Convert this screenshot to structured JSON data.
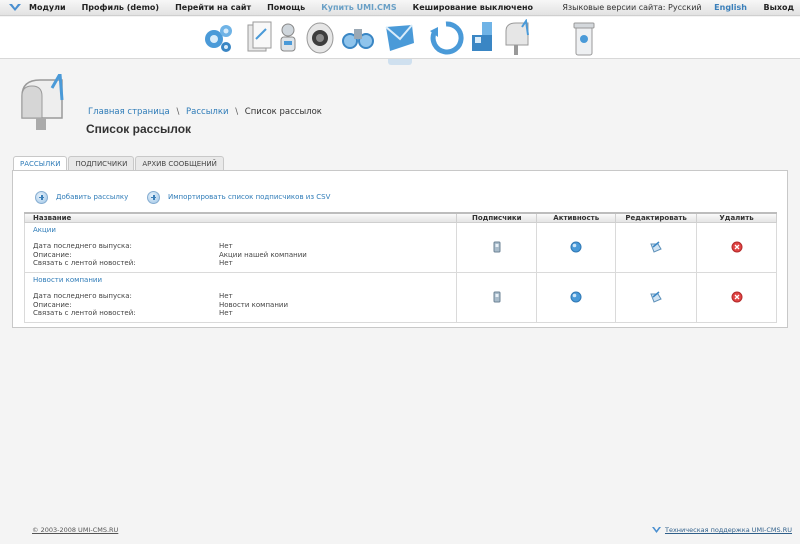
{
  "topbar": {
    "menu": [
      "Модули",
      "Профиль (demo)",
      "Перейти на сайт",
      "Помощь",
      "Купить UMI.CMS",
      "Кеширование выключено"
    ],
    "lang_label": "Языковые версии сайта: Русский",
    "lang_english": "English",
    "logout": "Выход"
  },
  "modules": [
    {
      "name": "settings-gears-icon"
    },
    {
      "name": "files-icon"
    },
    {
      "name": "users-icon"
    },
    {
      "name": "speaker-icon"
    },
    {
      "name": "binoculars-icon"
    },
    {
      "name": "dispatches-icon"
    },
    {
      "name": "sync-icon"
    },
    {
      "name": "data-blocks-icon"
    },
    {
      "name": "mailbox-icon"
    },
    {
      "name": "trash-icon"
    }
  ],
  "breadcrumb": {
    "home": "Главная страница",
    "section": "Рассылки",
    "current": "Список рассылок",
    "sep": "\\"
  },
  "page_title": "Список рассылок",
  "tabs": [
    "РАССЫЛКИ",
    "ПОДПИСЧИКИ",
    "АРХИВ СООБЩЕНИЙ"
  ],
  "actions": {
    "add": "Добавить рассылку",
    "import": "Импортировать список подписчиков из CSV"
  },
  "table": {
    "headers": {
      "name": "Название",
      "subscribers": "Подписчики",
      "activity": "Активность",
      "edit": "Редактировать",
      "delete": "Удалить"
    },
    "labels": {
      "last_issue": "Дата последнего выпуска:",
      "description": "Описание:",
      "news_link": "Связать с лентой новостей:"
    },
    "rows": [
      {
        "title": "Акции",
        "last_issue": "Нет",
        "description": "Акции нашей компании",
        "news_link": "Нет"
      },
      {
        "title": "Новости компании",
        "last_issue": "Нет",
        "description": "Новости компании",
        "news_link": "Нет"
      }
    ]
  },
  "footer": {
    "copyright": "© 2003-2008 UMI-CMS.RU",
    "support": "Техническая поддержка UMI-CMS.RU"
  },
  "colors": {
    "link": "#2f7cb8",
    "accent_blue": "#4a9ad8",
    "delete_red": "#e04444"
  }
}
